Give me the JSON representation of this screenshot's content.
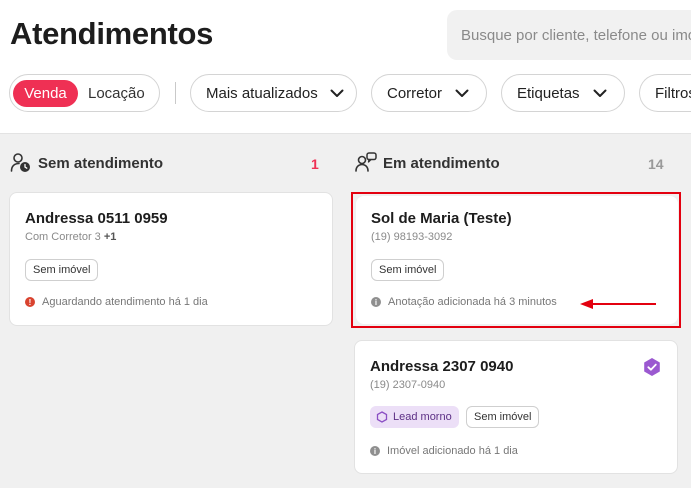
{
  "header": {
    "title": "Atendimentos",
    "search_placeholder": "Busque por cliente, telefone ou imóvel"
  },
  "toggle": {
    "active": "Venda",
    "inactive": "Locação"
  },
  "filters": [
    "Mais atualizados",
    "Corretor",
    "Etiquetas",
    "Filtros"
  ],
  "colors": {
    "accent": "#ef3054",
    "highlight": "#e3000f",
    "lead": "#9b59d0"
  },
  "columns": [
    {
      "title": "Sem atendimento",
      "count": "1",
      "icon": "user-clock-icon",
      "cards": [
        {
          "name": "Andressa 0511 0959",
          "sub_prefix": "Com Corretor 3",
          "sub_extra": "+1",
          "tags": [
            "Sem imóvel"
          ],
          "status": "Aguardando atendimento há 1 dia",
          "status_icon": "alert-icon"
        }
      ]
    },
    {
      "title": "Em atendimento",
      "count": "14",
      "icon": "users-chat-icon",
      "cards": [
        {
          "name": "Sol de Maria (Teste)",
          "phone": "(19) 98193-3092",
          "tags": [
            "Sem imóvel"
          ],
          "status": "Anotação adicionada há 3 minutos",
          "status_icon": "info-icon"
        },
        {
          "name": "Andressa 2307 0940",
          "phone": "(19) 2307-0940",
          "lead_tag": "Lead morno",
          "tags": [
            "Sem imóvel"
          ],
          "status": "Imóvel adicionado há 1 dia",
          "status_icon": "info-icon",
          "badge_icon": "verified-badge-icon"
        }
      ]
    }
  ]
}
